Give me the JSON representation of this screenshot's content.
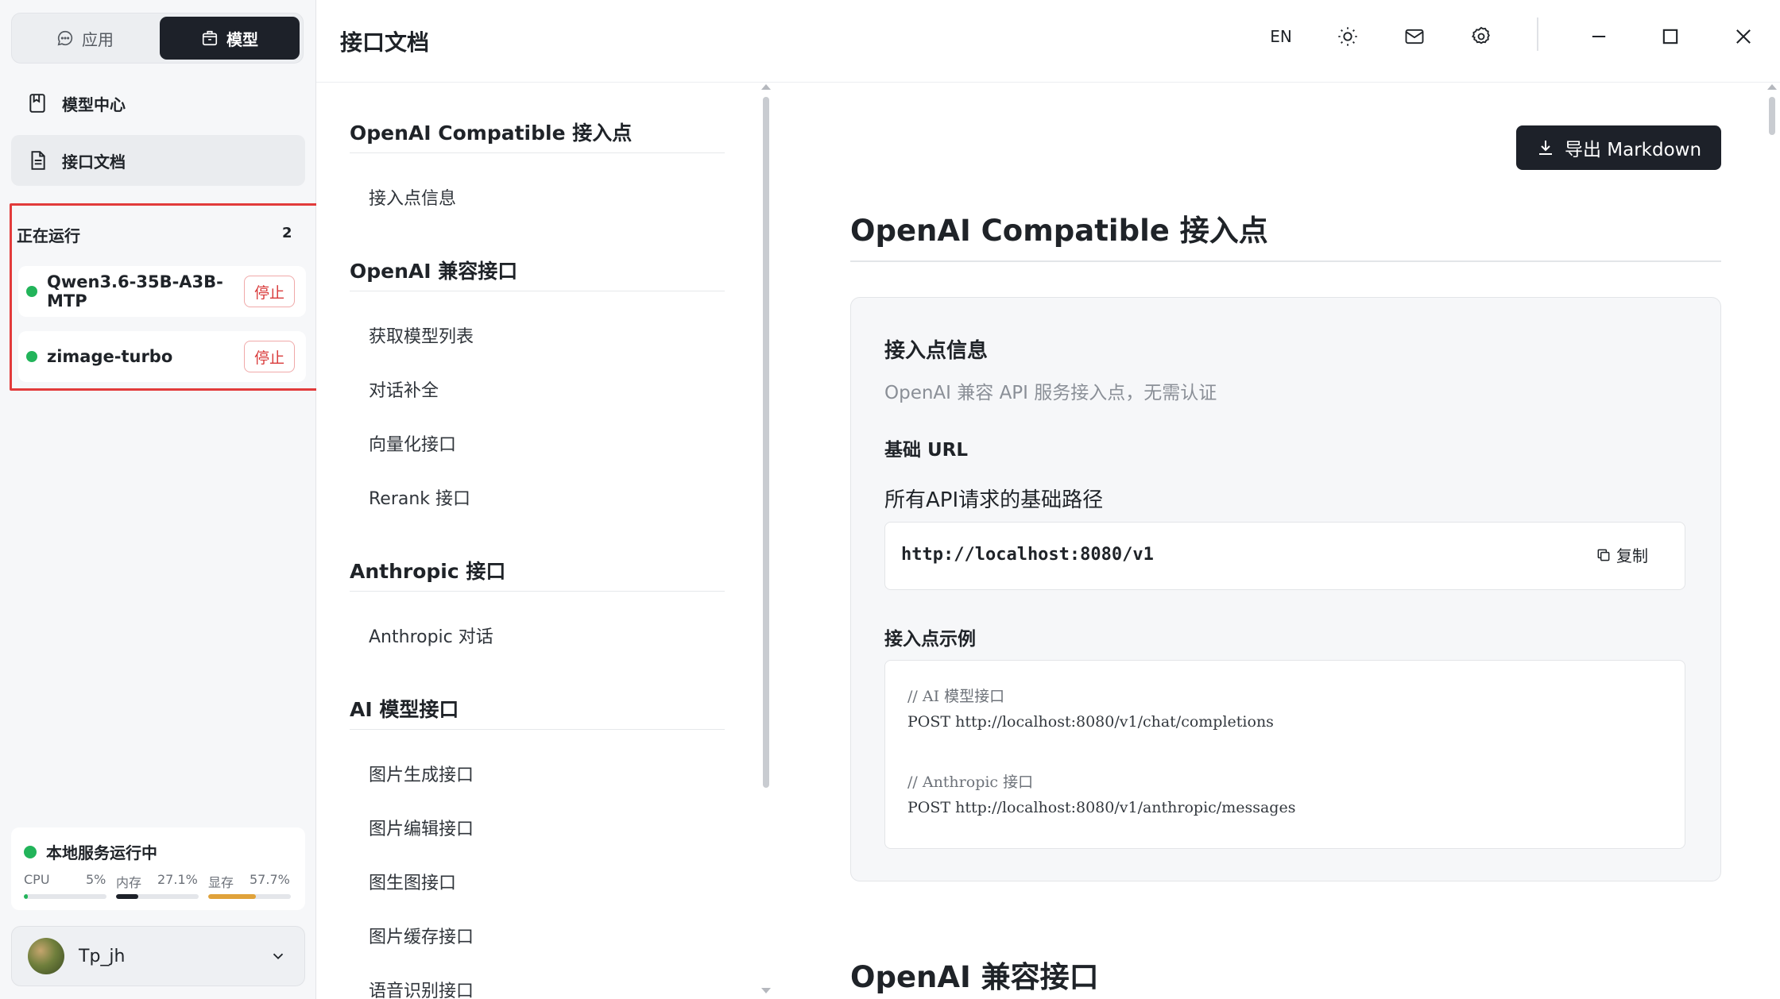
{
  "sidebar": {
    "segments": {
      "apps_label": "应用",
      "models_label": "模型"
    },
    "nav": [
      {
        "label": "模型中心"
      },
      {
        "label": "接口文档"
      }
    ],
    "running": {
      "title": "正在运行",
      "count": "2",
      "items": [
        {
          "name": "Qwen3.6-35B-A3B-MTP",
          "stop_label": "停止"
        },
        {
          "name": "zimage-turbo",
          "stop_label": "停止"
        }
      ]
    },
    "status": {
      "title": "本地服务运行中",
      "metrics": [
        {
          "label": "CPU",
          "value": "5%",
          "fraction": 0.05,
          "color": "#22b45a"
        },
        {
          "label": "内存",
          "value": "27.1%",
          "fraction": 0.271,
          "color": "#1d2129"
        },
        {
          "label": "显存",
          "value": "57.7%",
          "fraction": 0.577,
          "color": "#e0a23a"
        }
      ]
    },
    "user": {
      "name": "Tp_jh"
    }
  },
  "header": {
    "title": "接口文档",
    "lang_label": "EN",
    "icons": [
      "sun-icon",
      "mail-icon",
      "gear-icon",
      "minimize-icon",
      "maximize-icon",
      "close-icon"
    ]
  },
  "toc": {
    "sections": [
      {
        "title": "OpenAI Compatible 接入点",
        "items": [
          "接入点信息"
        ]
      },
      {
        "title": "OpenAI 兼容接口",
        "items": [
          "获取模型列表",
          "对话补全",
          "向量化接口",
          "Rerank 接口"
        ]
      },
      {
        "title": "Anthropic 接口",
        "items": [
          "Anthropic 对话"
        ]
      },
      {
        "title": "AI 模型接口",
        "items": [
          "图片生成接口",
          "图片编辑接口",
          "图生图接口",
          "图片缓存接口",
          "语音识别接口"
        ]
      }
    ]
  },
  "content": {
    "export_label": "导出 Markdown",
    "section1_title": "OpenAI Compatible 接入点",
    "card": {
      "title": "接入点信息",
      "desc": "OpenAI 兼容 API 服务接入点，无需认证",
      "base_url_label": "基础 URL",
      "base_url_desc": "所有API请求的基础路径",
      "base_url": "http://localhost:8080/v1",
      "copy_label": "复制",
      "example_label": "接入点示例",
      "code": [
        "// AI 模型接口",
        "POST http://localhost:8080/v1/chat/completions",
        "",
        "// Anthropic 接口",
        "POST http://localhost:8080/v1/anthropic/messages"
      ]
    },
    "section2_title": "OpenAI 兼容接口"
  }
}
